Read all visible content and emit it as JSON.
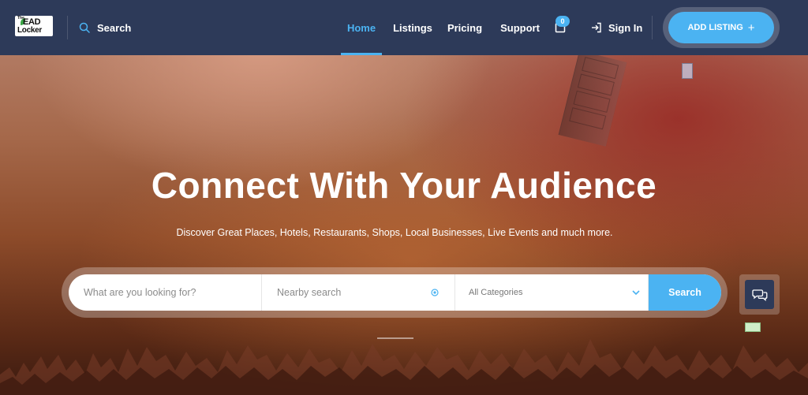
{
  "brand": {
    "logo_top": "The",
    "logo_mid": "EAD",
    "logo_bottom": "Locker"
  },
  "header": {
    "search_label": "Search",
    "nav": [
      {
        "label": "Home",
        "active": true
      },
      {
        "label": "Listings",
        "active": false
      },
      {
        "label": "Pricing",
        "active": false
      },
      {
        "label": "Support",
        "active": false
      }
    ],
    "cart_count": "0",
    "sign_in_label": "Sign In",
    "add_listing_label": "ADD LISTING",
    "add_listing_icon": "+"
  },
  "hero": {
    "title": "Connect With Your Audience",
    "subtitle": "Discover Great Places, Hotels, Restaurants, Shops, Local Businesses, Live Events and much more."
  },
  "search_form": {
    "keyword_placeholder": "What are you looking for?",
    "location_placeholder": "Nearby search",
    "category_value": "All Categories",
    "submit_label": "Search"
  },
  "colors": {
    "nav_bg": "#2d3a59",
    "accent": "#4bb3f2"
  }
}
